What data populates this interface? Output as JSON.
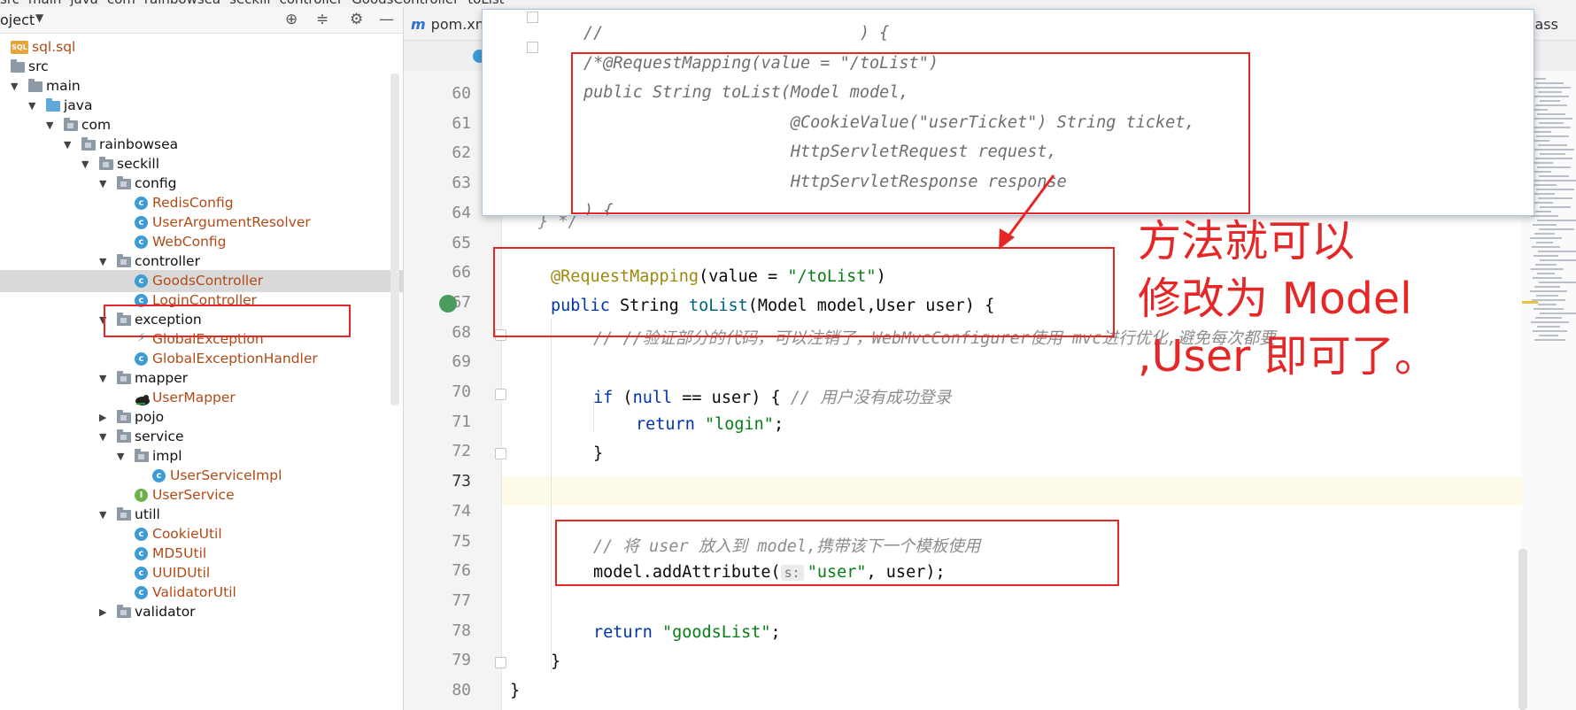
{
  "breadcrumb": [
    "src",
    "main",
    "java",
    "com",
    "rainbowsea",
    "seckill",
    "controller",
    "GoodsController",
    "toList"
  ],
  "project_panel": {
    "title": "oject",
    "icons": [
      "crosshair-icon",
      "collapse-icon",
      "gear-icon",
      "minimize-icon"
    ],
    "items": [
      {
        "label": "sql.sql",
        "kind": "sql",
        "indent": 0,
        "arrow": ""
      },
      {
        "label": "src",
        "kind": "folder",
        "indent": 0,
        "arrow": ""
      },
      {
        "label": "main",
        "kind": "folder",
        "indent": 1,
        "arrow": "open"
      },
      {
        "label": "java",
        "kind": "folder-blue",
        "indent": 2,
        "arrow": "open"
      },
      {
        "label": "com",
        "kind": "package",
        "indent": 3,
        "arrow": "open"
      },
      {
        "label": "rainbowsea",
        "kind": "package",
        "indent": 4,
        "arrow": "open"
      },
      {
        "label": "seckill",
        "kind": "package",
        "indent": 5,
        "arrow": "open"
      },
      {
        "label": "config",
        "kind": "package",
        "indent": 6,
        "arrow": "open"
      },
      {
        "label": "RedisConfig",
        "kind": "class",
        "indent": 7,
        "arrow": ""
      },
      {
        "label": "UserArgumentResolver",
        "kind": "class",
        "indent": 7,
        "arrow": ""
      },
      {
        "label": "WebConfig",
        "kind": "class",
        "indent": 7,
        "arrow": ""
      },
      {
        "label": "controller",
        "kind": "package",
        "indent": 6,
        "arrow": "open"
      },
      {
        "label": "GoodsController",
        "kind": "class",
        "indent": 7,
        "arrow": "",
        "selected": true
      },
      {
        "label": "LoginController",
        "kind": "class",
        "indent": 7,
        "arrow": ""
      },
      {
        "label": "exception",
        "kind": "package",
        "indent": 6,
        "arrow": "open"
      },
      {
        "label": "GlobalException",
        "kind": "bolt",
        "indent": 7,
        "arrow": ""
      },
      {
        "label": "GlobalExceptionHandler",
        "kind": "class",
        "indent": 7,
        "arrow": ""
      },
      {
        "label": "mapper",
        "kind": "package",
        "indent": 6,
        "arrow": "open"
      },
      {
        "label": "UserMapper",
        "kind": "bird",
        "indent": 7,
        "arrow": ""
      },
      {
        "label": "pojo",
        "kind": "package",
        "indent": 6,
        "arrow": "closed"
      },
      {
        "label": "service",
        "kind": "package",
        "indent": 6,
        "arrow": "open"
      },
      {
        "label": "impl",
        "kind": "package",
        "indent": 7,
        "arrow": "open"
      },
      {
        "label": "UserServiceImpl",
        "kind": "class",
        "indent": 8,
        "arrow": ""
      },
      {
        "label": "UserService",
        "kind": "interface",
        "indent": 7,
        "arrow": ""
      },
      {
        "label": "utill",
        "kind": "package",
        "indent": 6,
        "arrow": "open"
      },
      {
        "label": "CookieUtil",
        "kind": "class",
        "indent": 7,
        "arrow": ""
      },
      {
        "label": "MD5Util",
        "kind": "class",
        "indent": 7,
        "arrow": ""
      },
      {
        "label": "UUIDUtil",
        "kind": "class",
        "indent": 7,
        "arrow": ""
      },
      {
        "label": "ValidatorUtil",
        "kind": "class",
        "indent": 7,
        "arrow": ""
      },
      {
        "label": "validator",
        "kind": "package",
        "indent": 6,
        "arrow": "closed"
      }
    ]
  },
  "editor": {
    "tab_pom": "pom.xml",
    "tab_right": "lass",
    "line_numbers": [
      "60",
      "61",
      "62",
      "63",
      "64",
      "65",
      "66",
      "67",
      "68",
      "69",
      "70",
      "71",
      "72",
      "73",
      "74",
      "75",
      "76",
      "77",
      "78",
      "79",
      "80"
    ],
    "current_line": "73",
    "code": {
      "l64": "} */",
      "l66_ann": "@RequestMapping",
      "l66_a": "(value = ",
      "l66_s": "\"/toList\"",
      "l66_b": ")",
      "l67_kw": "public",
      "l67_a": " String ",
      "l67_fn": "toList",
      "l67_b": "(Model model,User user) {",
      "l68_cm": "// //验证部分的代码，可以注销了，WebMvcConfigurer使用 mvc进行优化,避免每次都要",
      "l70_kw": "if",
      "l70_a": " (",
      "l70_kw2": "null",
      "l70_b": " == user) { ",
      "l70_cm": "// 用户没有成功登录",
      "l71_kw": "return",
      "l71_s": "\"login\"",
      "l71_b": ";",
      "l72": "}",
      "l75_cm": "// 将 user 放入到 model,携带该下一个模板使用",
      "l76_a": "model.addAttribute(",
      "l76_hint": "s:",
      "l76_s": "\"user\"",
      "l76_b": ", user);",
      "l78_kw": "return",
      "l78_s": "\"goodsList\"",
      "l78_b": ";",
      "l79": "}",
      "l80": "}"
    }
  },
  "popup": {
    "lines": [
      "//                          ) {",
      "/*@RequestMapping(value = \"/toList\")",
      "public String toList(Model model,",
      "                     @CookieValue(\"userTicket\") String ticket,",
      "                     HttpServletRequest request,",
      "                     HttpServletResponse response",
      ") {"
    ]
  },
  "annotation": {
    "note_lines": [
      "方法就可以",
      "修改为 Model",
      ",User 即可了。"
    ],
    "color": "#e52727"
  }
}
